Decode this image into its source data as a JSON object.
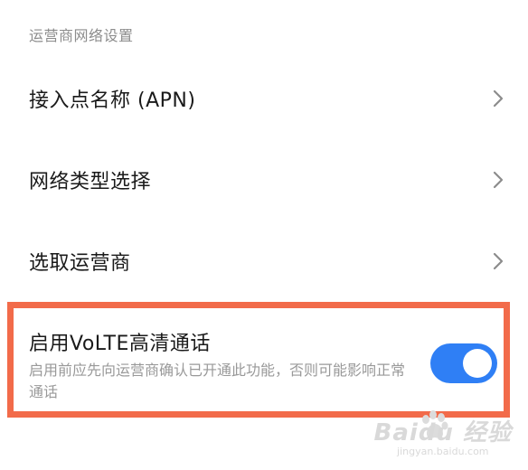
{
  "section": {
    "title": "运营商网络设置"
  },
  "items": [
    {
      "label": "接入点名称 (APN)"
    },
    {
      "label": "网络类型选择"
    },
    {
      "label": "选取运营商"
    }
  ],
  "volte": {
    "title": "启用VoLTE高清通话",
    "description": "启用前应先向运营商确认已开通此功能，否则可能影响正常通话",
    "enabled": true
  },
  "watermark": {
    "main": "Baidu 经验",
    "sub": "jingyan.baidu.com"
  },
  "colors": {
    "accent": "#2f7ff5",
    "highlight": "#f26b4a"
  },
  "icons": {
    "chevron": "chevron-right-icon",
    "watermark": "baidu-paw-icon"
  }
}
